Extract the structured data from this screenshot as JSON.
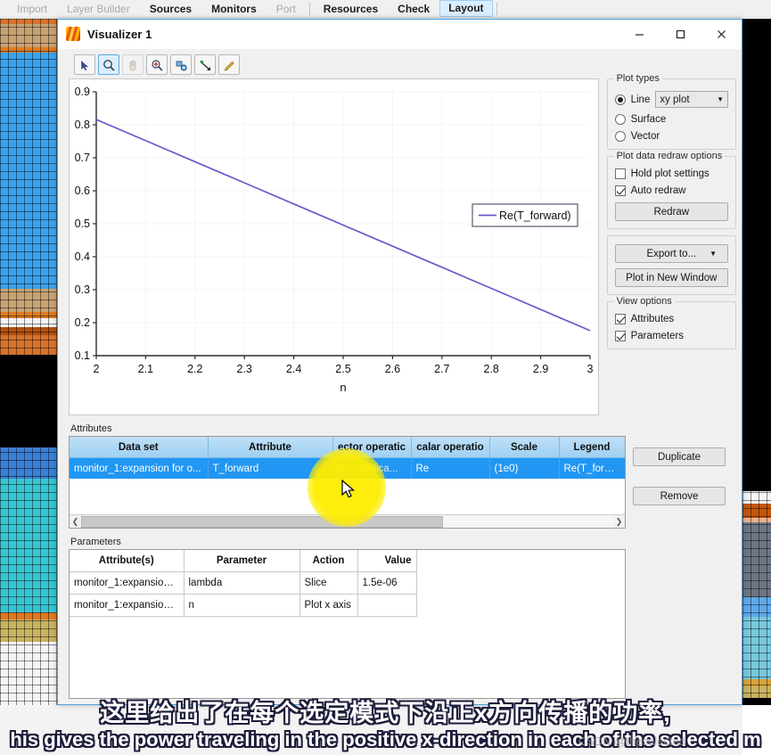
{
  "background": {
    "menubar": [
      {
        "label": "Import",
        "state": "dim"
      },
      {
        "label": "Layer Builder",
        "state": "dim"
      },
      {
        "label": "Sources",
        "state": "normal"
      },
      {
        "label": "Monitors",
        "state": "normal"
      },
      {
        "label": "Port",
        "state": "dim"
      },
      {
        "label": "Resources",
        "state": "normal"
      },
      {
        "label": "Check",
        "state": "normal"
      },
      {
        "label": "Layout",
        "state": "active"
      }
    ]
  },
  "window": {
    "title": "Visualizer 1",
    "logo_icon": "lumerical-logo-icon",
    "minimize_icon": "minimize-icon",
    "maximize_icon": "maximize-icon",
    "close_icon": "close-icon"
  },
  "toolbar": [
    {
      "icon": "pointer-icon",
      "selected": false,
      "disabled": false
    },
    {
      "icon": "zoom-icon",
      "selected": true,
      "disabled": false
    },
    {
      "icon": "pan-hand-icon",
      "selected": false,
      "disabled": true
    },
    {
      "icon": "zoom-fit-icon",
      "selected": false,
      "disabled": false
    },
    {
      "icon": "add-marker-icon",
      "selected": false,
      "disabled": false
    },
    {
      "icon": "line-cursor-icon",
      "selected": false,
      "disabled": false
    },
    {
      "icon": "pencil-icon",
      "selected": false,
      "disabled": false
    }
  ],
  "chart_data": {
    "type": "line",
    "title": "",
    "xlabel": "n",
    "ylabel": "",
    "xlim": [
      2,
      3
    ],
    "ylim": [
      0.1,
      0.9
    ],
    "xticks": [
      "2",
      "2.1",
      "2.2",
      "2.3",
      "2.4",
      "2.5",
      "2.6",
      "2.7",
      "2.8",
      "2.9",
      "3"
    ],
    "yticks": [
      "0.1",
      "0.2",
      "0.3",
      "0.4",
      "0.5",
      "0.6",
      "0.7",
      "0.8",
      "0.9"
    ],
    "grid": true,
    "legend_position": "inside-right",
    "series": [
      {
        "name": "Re(T_forward)",
        "color": "#6a5acd",
        "x": [
          2.0,
          2.1,
          2.2,
          2.3,
          2.4,
          2.5,
          2.6,
          2.7,
          2.8,
          2.9,
          3.0
        ],
        "values": [
          0.816,
          0.752,
          0.688,
          0.624,
          0.56,
          0.496,
          0.432,
          0.368,
          0.304,
          0.24,
          0.176
        ]
      }
    ]
  },
  "plot_types": {
    "legend": "Plot types",
    "options": [
      {
        "label": "Line",
        "selected": true
      },
      {
        "label": "Surface",
        "selected": false
      },
      {
        "label": "Vector",
        "selected": false
      }
    ],
    "plot_style": "xy plot",
    "caret_icon": "chevron-down-icon"
  },
  "redraw_options": {
    "legend": "Plot data redraw options",
    "checkboxes": [
      {
        "label": "Hold plot settings",
        "checked": false
      },
      {
        "label": "Auto redraw",
        "checked": true
      }
    ],
    "redraw_button": "Redraw"
  },
  "export_group": {
    "export_button": "Export to...",
    "export_caret_icon": "chevron-down-icon",
    "new_window_button": "Plot in New Window"
  },
  "view_options": {
    "legend": "View options",
    "checkboxes": [
      {
        "label": "Attributes",
        "checked": true
      },
      {
        "label": "Parameters",
        "checked": true
      }
    ]
  },
  "attributes": {
    "section_label": "Attributes",
    "columns": [
      "Data set",
      "Attribute",
      "ector operatic",
      "calar operatio",
      "Scale",
      "Legend"
    ],
    "rows": [
      {
        "data_set": "monitor_1:expansion for o...",
        "attribute": "T_forward",
        "vector_operation": "Not Applica...",
        "scalar_operation": "Re",
        "scale": "(1e0)",
        "legend": "Re(T_forward)",
        "selected": true
      }
    ],
    "buttons": {
      "duplicate": "Duplicate",
      "remove": "Remove"
    },
    "scroll_left_icon": "chevron-left-icon",
    "scroll_right_icon": "chevron-right-icon"
  },
  "parameters": {
    "section_label": "Parameters",
    "columns": [
      "Attribute(s)",
      "Parameter",
      "Action",
      "Value"
    ],
    "rows": [
      {
        "attributes": "monitor_1:expansion ...",
        "parameter": "lambda",
        "action": "Slice",
        "value": "1.5e-06"
      },
      {
        "attributes": "monitor_1:expansion ...",
        "parameter": "n",
        "action": "Plot x axis",
        "value": ""
      }
    ]
  },
  "subtitles": {
    "chinese": "这里给出了在每个选定模式下沿正x方向传播的功率,",
    "english": "his gives the power traveling in the positive x-direction in each of the selected m",
    "watermark": "CSDN @theselected"
  },
  "cursor": {
    "icon": "mouse-pointer-icon",
    "highlight_color": "#ffed00"
  }
}
